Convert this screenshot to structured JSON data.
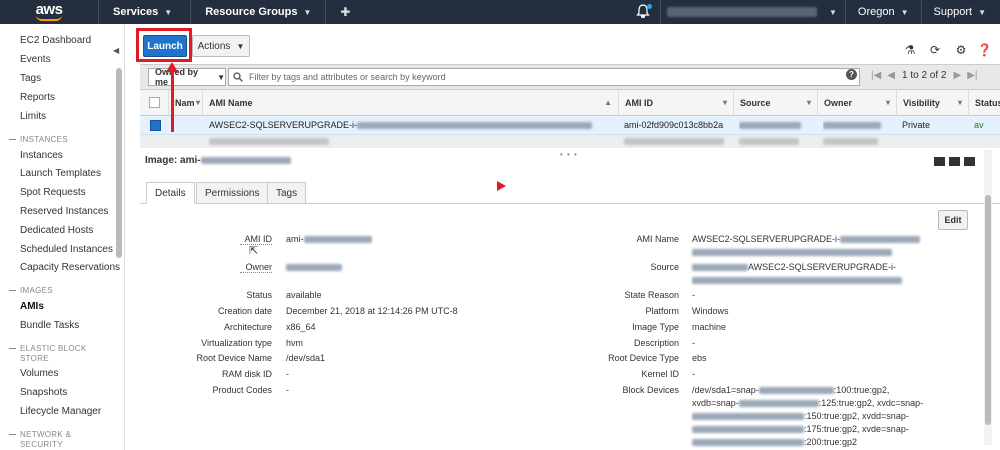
{
  "topbar": {
    "logo": "aws",
    "services": "Services",
    "resource_groups": "Resource Groups",
    "region": "Oregon",
    "support": "Support"
  },
  "sidebar": {
    "items": [
      "EC2 Dashboard",
      "Events",
      "Tags",
      "Reports",
      "Limits"
    ],
    "instances_head": "INSTANCES",
    "instances": [
      "Instances",
      "Launch Templates",
      "Spot Requests",
      "Reserved Instances",
      "Dedicated Hosts",
      "Scheduled Instances",
      "Capacity Reservations"
    ],
    "images_head": "IMAGES",
    "images": [
      "AMIs",
      "Bundle Tasks"
    ],
    "ebs_head_1": "ELASTIC BLOCK",
    "ebs_head_2": "STORE",
    "ebs": [
      "Volumes",
      "Snapshots",
      "Lifecycle Manager"
    ],
    "network_head_1": "NETWORK &",
    "network_head_2": "SECURITY"
  },
  "toolbar": {
    "launch": "Launch",
    "actions": "Actions"
  },
  "filter": {
    "owned": "Owned by me",
    "placeholder": "Filter by tags and attributes or search by keyword",
    "page": "1 to 2 of 2"
  },
  "columns": [
    "Nam",
    "AMI Name",
    "AMI ID",
    "Source",
    "Owner",
    "Visibility",
    "Status"
  ],
  "row": {
    "ami_name": "AWSEC2-SQLSERVERUPGRADE-i-",
    "ami_id": "ami-02fd909c013c8bb2a",
    "visibility": "Private",
    "status": "av"
  },
  "detail": {
    "title": "Image: ami-",
    "tabs": [
      "Details",
      "Permissions",
      "Tags"
    ],
    "edit": "Edit",
    "left": [
      {
        "label": "AMI ID",
        "value": "ami-"
      },
      {
        "label": "Owner",
        "value": ""
      },
      {
        "label": "Status",
        "value": "available"
      },
      {
        "label": "Creation date",
        "value": "December 21, 2018 at 12:14:26 PM UTC-8"
      },
      {
        "label": "Architecture",
        "value": "x86_64"
      },
      {
        "label": "Virtualization type",
        "value": "hvm"
      },
      {
        "label": "Root Device Name",
        "value": "/dev/sda1"
      },
      {
        "label": "RAM disk ID",
        "value": "-"
      },
      {
        "label": "Product Codes",
        "value": "-"
      }
    ],
    "right": {
      "ami_name_label": "AMI Name",
      "ami_name_value": "AWSEC2-SQLSERVERUPGRADE-i-",
      "source_label": "Source",
      "source_value": "AWSEC2-SQLSERVERUPGRADE-i-",
      "state_reason_label": "State Reason",
      "state_reason_value": "-",
      "platform_label": "Platform",
      "platform_value": "Windows",
      "image_type_label": "Image Type",
      "image_type_value": "machine",
      "description_label": "Description",
      "description_value": "-",
      "root_device_type_label": "Root Device Type",
      "root_device_type_value": "ebs",
      "kernel_id_label": "Kernel ID",
      "kernel_id_value": "-",
      "block_devices_label": "Block Devices",
      "bd1a": "/dev/sda1=snap-",
      "bd1b": ":100:true:gp2,",
      "bd2a": "xvdb=snap-",
      "bd2b": ":125:true:gp2, xvdc=snap-",
      "bd3b": ":150:true:gp2, xvdd=snap-",
      "bd4b": ":175:true:gp2, xvde=snap-",
      "bd5b": ":200:true:gp2"
    }
  }
}
